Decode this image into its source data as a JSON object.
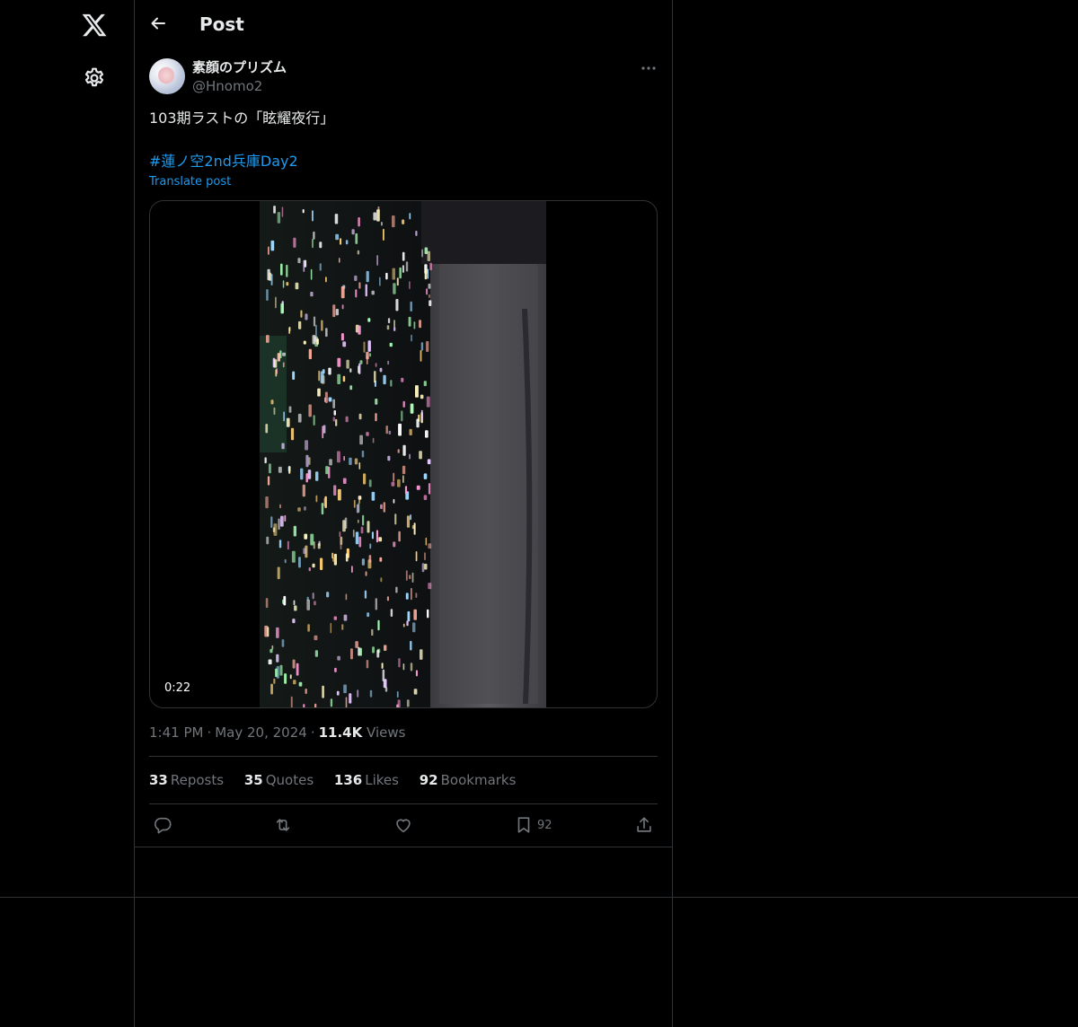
{
  "nav": {
    "logo_icon": "x-logo-icon",
    "settings_icon": "gear-icon"
  },
  "header": {
    "back_icon": "arrow-left-icon",
    "title": "Post"
  },
  "post": {
    "author_name": "素顔のプリズム",
    "author_handle": "@Hnomo2",
    "text": "103期ラストの「眩耀夜行」",
    "hashtag": "#蓮ノ空2nd兵庫Day2",
    "translate_label": "Translate post",
    "video": {
      "duration": "0:22"
    },
    "time": "1:41 PM",
    "date": "May 20, 2024",
    "views_count": "11.4K",
    "views_label": "Views",
    "stats": [
      {
        "count": "33",
        "label": "Reposts"
      },
      {
        "count": "35",
        "label": "Quotes"
      },
      {
        "count": "136",
        "label": "Likes"
      },
      {
        "count": "92",
        "label": "Bookmarks"
      }
    ],
    "actions": {
      "reply_icon": "reply-icon",
      "repost_icon": "repost-icon",
      "like_icon": "heart-icon",
      "bookmark_icon": "bookmark-icon",
      "bookmark_count": "92",
      "share_icon": "share-icon"
    }
  },
  "colors": {
    "background": "#000000",
    "text": "#e7e9ea",
    "muted": "#71767b",
    "accent": "#1d9bf0",
    "border": "#2f3336"
  }
}
